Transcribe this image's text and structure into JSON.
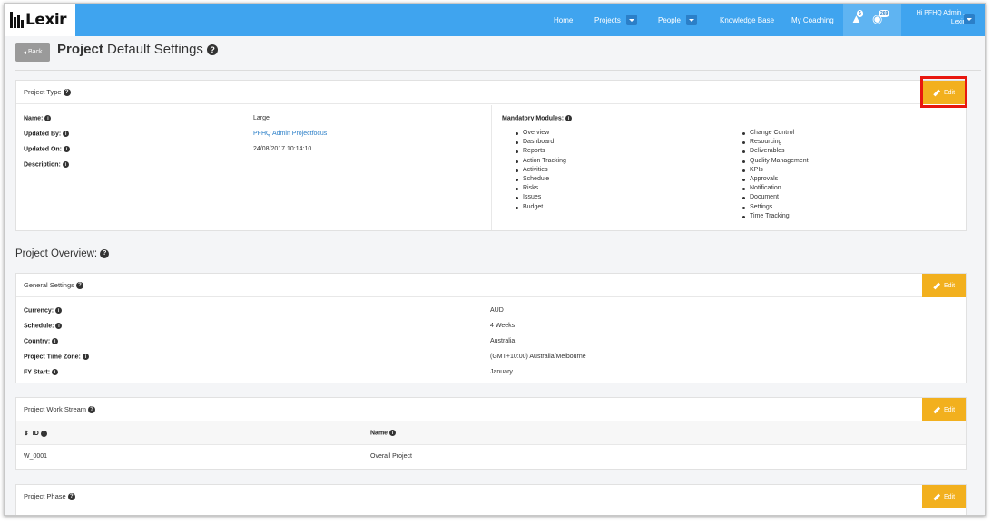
{
  "nav": {
    "logo_text": "Lexir",
    "items": [
      "Home",
      "Projects",
      "People",
      "Knowledge Base",
      "My Coaching"
    ],
    "alerts_count": "6",
    "messages_count": "269",
    "user_line1": "Hi PFHQ Admin ,",
    "user_line2": "Lexir"
  },
  "header": {
    "back_label": "Back",
    "title_bold": "Project",
    "title_rest": "Default Settings"
  },
  "project_type": {
    "heading": "Project Type",
    "edit_label": "Edit",
    "name_label": "Name:",
    "name_value": "Large",
    "updated_by_label": "Updated By:",
    "updated_by_value": "PFHQ Admin Projectfocus",
    "updated_on_label": "Updated On:",
    "updated_on_value": "24/08/2017 10:14:10",
    "description_label": "Description:",
    "modules_label": "Mandatory Modules:",
    "modules_col1": [
      "Overview",
      "Dashboard",
      "Reports",
      "Action Tracking",
      "Activities",
      "Schedule",
      "Risks",
      "Issues",
      "Budget"
    ],
    "modules_col2": [
      "Change Control",
      "Resourcing",
      "Deliverables",
      "Quality Management",
      "KPIs",
      "Approvals",
      "Notification",
      "Document",
      "Settings",
      "Time Tracking"
    ]
  },
  "overview_title": "Project Overview:",
  "general": {
    "heading": "General Settings",
    "edit_label": "Edit",
    "rows": [
      {
        "label": "Currency:",
        "value": "AUD"
      },
      {
        "label": "Schedule:",
        "value": "4 Weeks"
      },
      {
        "label": "Country:",
        "value": "Australia"
      },
      {
        "label": "Project Time Zone:",
        "value": "(GMT+10:00) Australia/Melbourne"
      },
      {
        "label": "FY Start:",
        "value": "January"
      }
    ]
  },
  "work_stream": {
    "heading": "Project Work Stream",
    "edit_label": "Edit",
    "col_id": "ID",
    "col_name": "Name",
    "row_id": "W_0001",
    "row_name": "Overall Project"
  },
  "phase": {
    "heading": "Project Phase",
    "edit_label": "Edit"
  },
  "colors": {
    "nav_blue": "#3fa4ef",
    "edit_orange": "#f2b01e",
    "highlight_red": "#e8170f",
    "link_blue": "#2b7fc8"
  }
}
